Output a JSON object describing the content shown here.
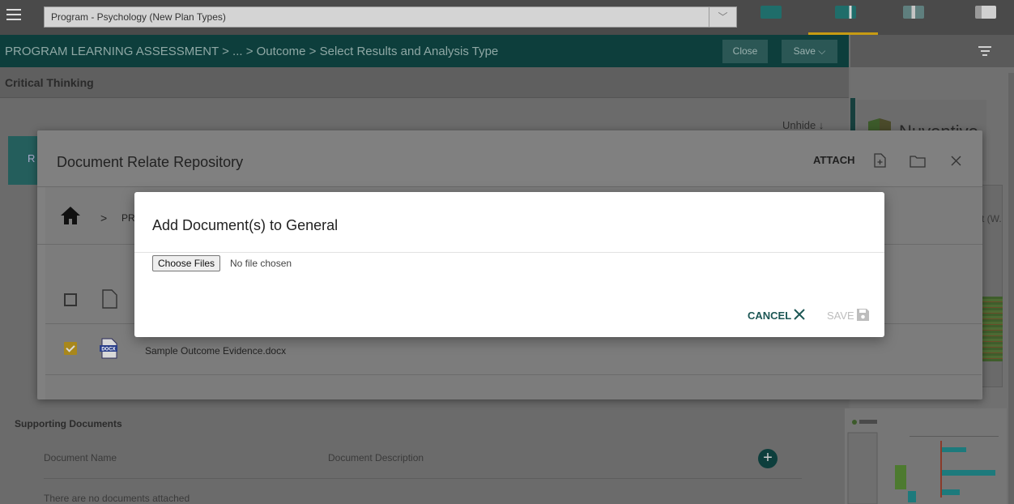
{
  "topbar": {
    "program_select": "Program - Psychology (New Plan Types)",
    "dropdown_glyph": "﹀"
  },
  "breadcrumb": {
    "path": "PROGRAM LEARNING ASSESSMENT  >  ...  >  Outcome  >  Select Results and Analysis Type",
    "close_label": "Close",
    "save_label": "Save ⌵"
  },
  "section": {
    "title": "Critical Thinking",
    "unhide_label": "Unhide ↓",
    "tab_initial": "R"
  },
  "supporting": {
    "title": "Supporting Documents",
    "col_name": "Document Name",
    "col_description": "Document Description",
    "empty_text": "There are no documents attached"
  },
  "right_panel": {
    "logo_text": "Nuventive.",
    "truncated_text": "t (W."
  },
  "repository_modal": {
    "title": "Document Relate Repository",
    "attach_label": "ATTACH",
    "path_chevron": ">",
    "path_text": "PR",
    "rows": [
      {
        "name": "",
        "checked": false
      },
      {
        "name": "Sample Outcome Evidence.docx",
        "checked": true
      }
    ]
  },
  "add_modal": {
    "title": "Add Document(s) to General",
    "choose_files_label": "Choose Files",
    "no_file_text": "No file chosen",
    "cancel_label": "CANCEL",
    "save_label": "SAVE"
  },
  "colors": {
    "accent_teal": "#0d3e3c",
    "checkbox_gold": "#a8871c"
  }
}
